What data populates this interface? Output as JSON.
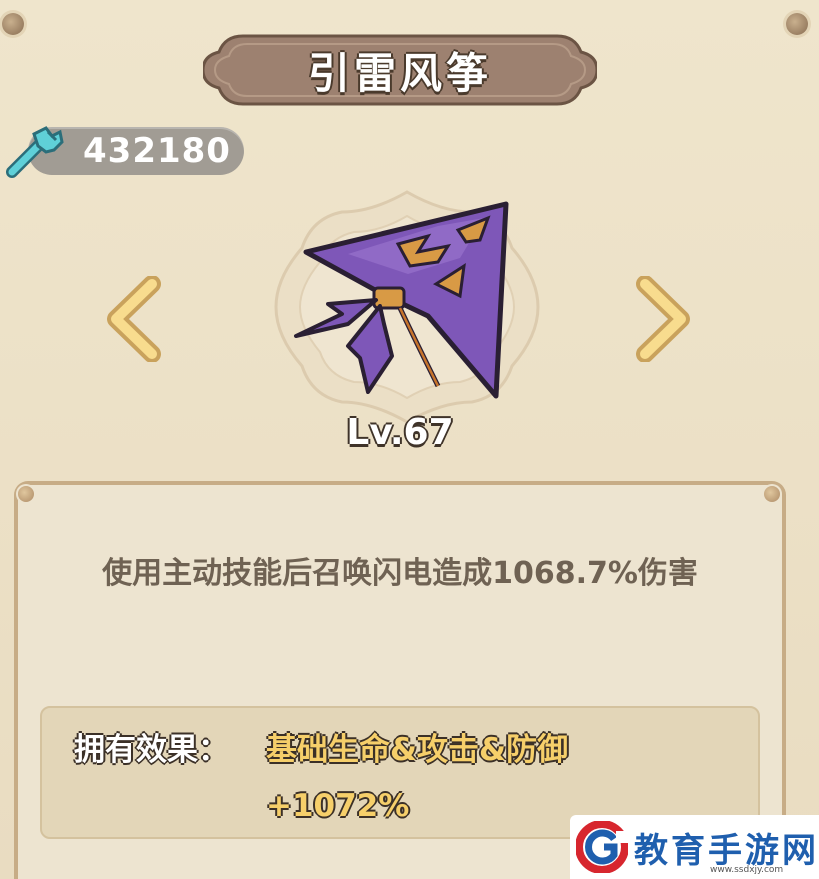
{
  "item": {
    "name": "引雷风筝",
    "level": "Lv.67",
    "description": "使用主动技能后召唤闪电造成1068.7%伤害"
  },
  "currency": {
    "amount": "432180",
    "icon": "wrench-icon"
  },
  "effect": {
    "label": "拥有效果：",
    "value": "基础生命&攻击&防御+1072%"
  },
  "navigation": {
    "prev_icon": "chevron-left-icon",
    "next_icon": "chevron-right-icon"
  },
  "watermark": {
    "text": "教育手游网",
    "url": "www.ssdxjy.com"
  },
  "colors": {
    "background": "#ece1c8",
    "plaque": "#9d8170",
    "accent_gold": "#f6cf6a",
    "text_brown": "#6f6253",
    "kite_purple": "#7e57b8"
  }
}
